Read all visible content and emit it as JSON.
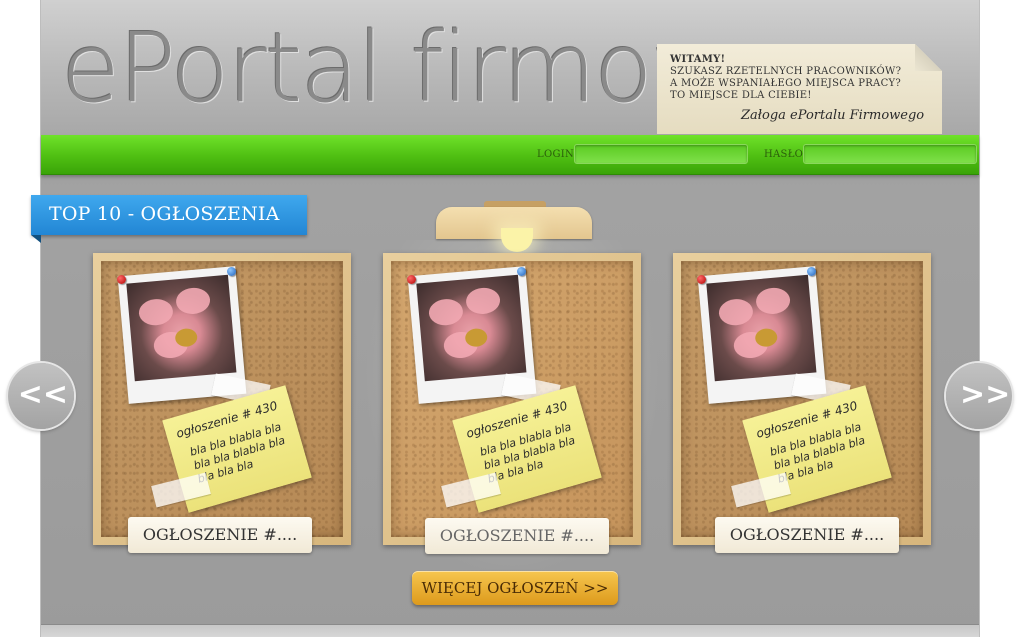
{
  "header": {
    "logo": "ePortal firmowy",
    "note": {
      "lines": [
        "WITAMY!",
        "SZUKASZ RZETELNYCH PRACOWNIKÓW?",
        "A MOŻE WSPANIAŁEGO MIEJSCA PRACY?",
        "TO MIEJSCE DLA CIEBIE!"
      ],
      "signature": "Załoga ePortalu Firmowego"
    }
  },
  "login": {
    "login_label": "LOGIN",
    "login_value": "",
    "password_label": "HASŁO",
    "password_value": ""
  },
  "section": {
    "title": "TOP 10 - OGŁOSZENIA"
  },
  "carousel": {
    "prev_label": "<<",
    "next_label": ">>",
    "cards": [
      {
        "note_title": "ogłoszenie # 430",
        "note_body": "bla bla blabla bla bla bla blabla bla bla bla bla",
        "button": "OGŁOSZENIE #...."
      },
      {
        "note_title": "ogłoszenie # 430",
        "note_body": "bla bla blabla bla bla bla blabla bla bla bla bla",
        "button": "OGŁOSZENIE #...."
      },
      {
        "note_title": "ogłoszenie # 430",
        "note_body": "bla bla blabla bla bla bla blabla bla bla bla bla",
        "button": "OGŁOSZENIE #...."
      }
    ]
  },
  "more_button": "WIĘCEJ OGŁOSZEŃ >>",
  "colors": {
    "accent_green": "#4fbf12",
    "ribbon_blue": "#2286d4",
    "button_gold": "#e8a928",
    "cork": "#bf9460"
  }
}
